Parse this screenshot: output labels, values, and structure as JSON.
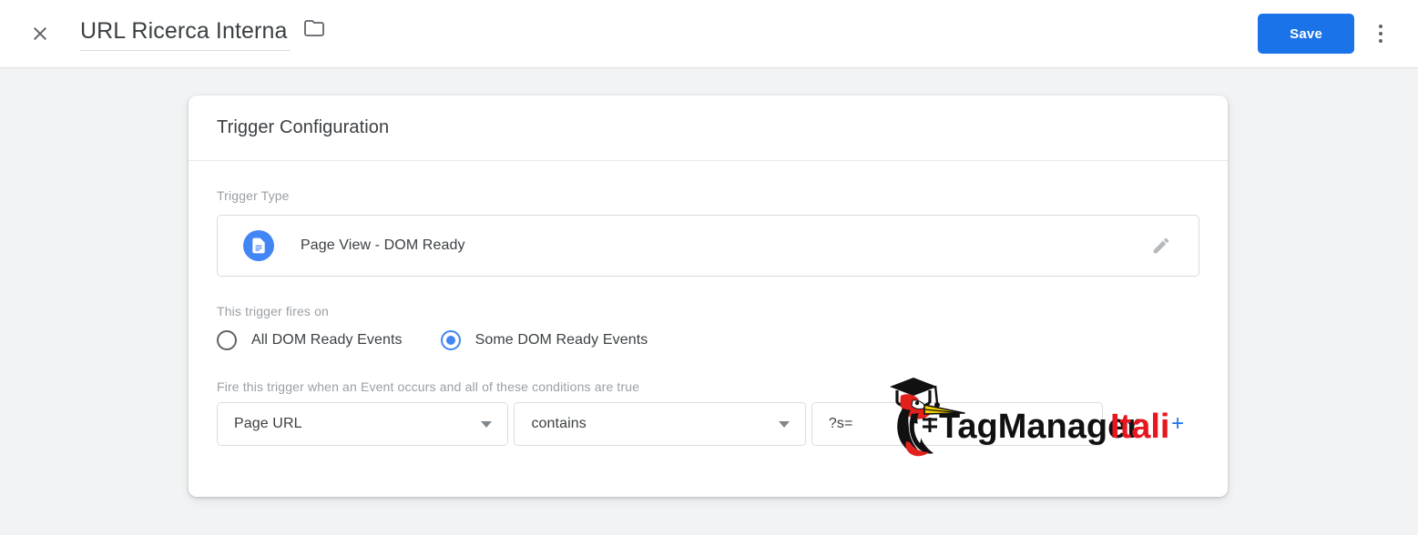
{
  "topbar": {
    "close_icon": "close-icon",
    "title_value": "URL Ricerca Interna",
    "folder_icon": "folder-icon",
    "save_label": "Save",
    "more_icon": "more-vert-icon"
  },
  "card": {
    "header_title": "Trigger Configuration",
    "trigger_type": {
      "label": "Trigger Type",
      "icon": "page-view-icon",
      "name": "Page View - DOM Ready",
      "edit_icon": "pencil-icon"
    },
    "fires_on": {
      "label": "This trigger fires on",
      "options": [
        {
          "label": "All DOM Ready Events",
          "selected": false
        },
        {
          "label": "Some DOM Ready Events",
          "selected": true
        }
      ]
    },
    "conditions": {
      "label": "Fire this trigger when an Event occurs and all of these conditions are true",
      "rows": [
        {
          "variable": "Page URL",
          "operator": "contains",
          "value": "?s=",
          "value_placeholder": "",
          "remove_label": "−",
          "add_label": "+"
        }
      ]
    }
  },
  "watermark": {
    "name": "tagmanageritalia-logo",
    "text_black": "TagManager",
    "text_red": "Italia"
  },
  "colors": {
    "accent_blue": "#1a73e8",
    "icon_blue": "#4285f4",
    "page_bg": "#f1f3f4",
    "card_bg": "#ffffff",
    "label_gray": "#9aa0a6",
    "text_dark": "#3c4043",
    "logo_red": "#e8161d"
  }
}
